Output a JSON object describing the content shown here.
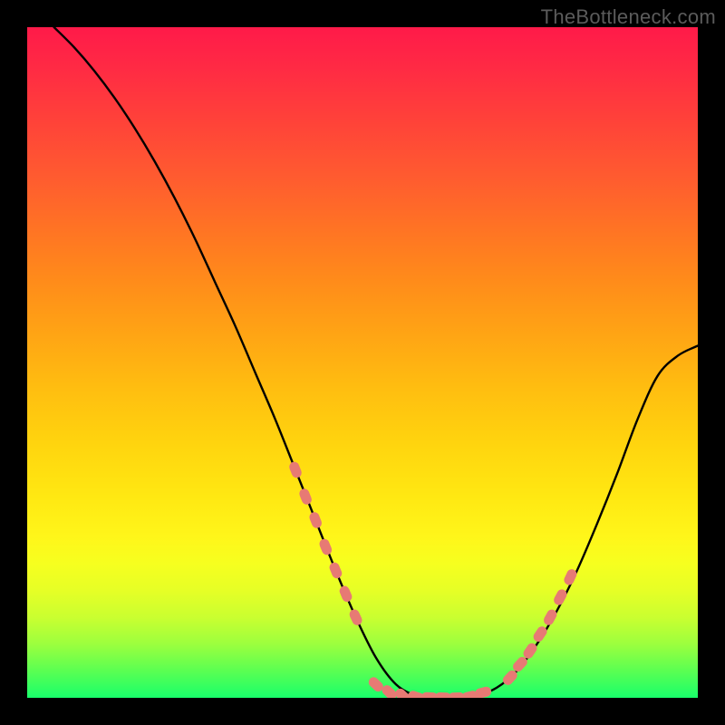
{
  "watermark": "TheBottleneck.com",
  "colors": {
    "background": "#000000",
    "curve": "#000000",
    "marker_fill": "#e77a74",
    "marker_stroke": "#e77a74",
    "gradient_top": "#ff1a49",
    "gradient_bottom": "#19ff6b"
  },
  "chart_data": {
    "type": "line",
    "title": "",
    "xlabel": "",
    "ylabel": "",
    "xlim": [
      0,
      100
    ],
    "ylim": [
      0,
      100
    ],
    "grid": false,
    "legend": false,
    "series": [
      {
        "name": "bottleneck-curve",
        "x": [
          4,
          7,
          10,
          13,
          16,
          19,
          22,
          25,
          28,
          31,
          34,
          37,
          40,
          43,
          46,
          49,
          52,
          55,
          58,
          61,
          64,
          67,
          70,
          73,
          76,
          79,
          82,
          85,
          88,
          91,
          94,
          97,
          100
        ],
        "y": [
          100,
          97,
          93.5,
          89.5,
          85,
          80,
          74.5,
          68.5,
          62,
          55.5,
          48.5,
          41.5,
          34,
          26.5,
          19,
          12,
          6,
          2,
          0.3,
          0,
          0,
          0.3,
          1.5,
          4,
          8,
          13,
          19,
          26,
          33.5,
          41.5,
          48,
          51,
          52.5
        ]
      }
    ],
    "marker_clusters": [
      {
        "name": "left-slope-markers",
        "x": [
          40,
          41.5,
          43,
          44.5,
          46,
          47.5,
          49
        ],
        "y": [
          34,
          30,
          26.5,
          22.5,
          19,
          15.5,
          12
        ]
      },
      {
        "name": "valley-markers",
        "x": [
          52,
          54,
          56,
          58,
          60,
          62,
          64,
          66,
          68
        ],
        "y": [
          2,
          0.8,
          0.3,
          0.15,
          0.08,
          0.05,
          0.05,
          0.2,
          0.8
        ]
      },
      {
        "name": "right-slope-markers",
        "x": [
          72,
          73.5,
          75,
          76.5,
          78,
          79.5,
          81
        ],
        "y": [
          3,
          5,
          7,
          9.5,
          12,
          15,
          18
        ]
      }
    ]
  }
}
